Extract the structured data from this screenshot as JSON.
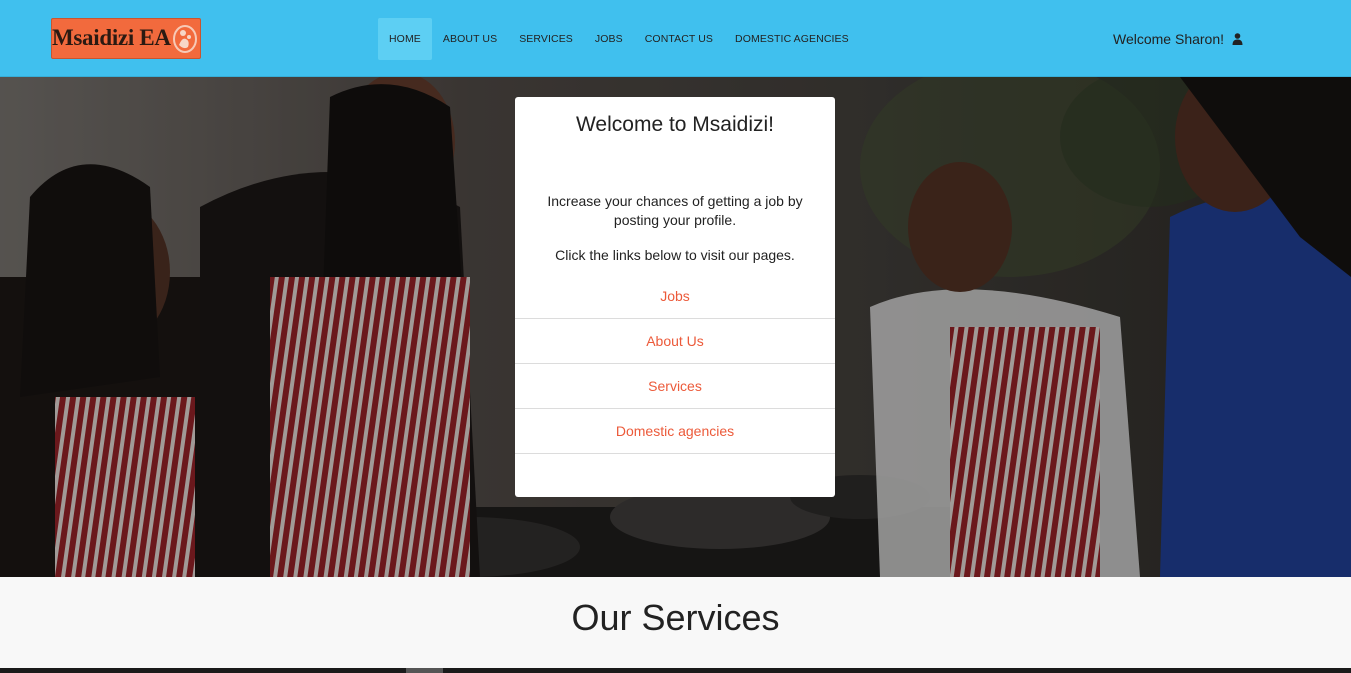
{
  "brand": {
    "logo_text": "Msaidizi EA",
    "logo_bg": "#f26a3d",
    "icon": "logo-mark-icon"
  },
  "nav": {
    "items": [
      {
        "label": "HOME",
        "active": true
      },
      {
        "label": "ABOUT US"
      },
      {
        "label": "SERVICES"
      },
      {
        "label": "JOBS"
      },
      {
        "label": "CONTACT US"
      },
      {
        "label": "DOMESTIC AGENCIES"
      }
    ],
    "bg": "#40c0ee"
  },
  "user": {
    "welcome": "Welcome Sharon!",
    "icon": "user-icon"
  },
  "card": {
    "title": "Welcome to Msaidizi!",
    "text1": "Increase your chances of getting a job by posting your profile.",
    "text2": "Click the links below to visit our pages.",
    "links": [
      "Jobs",
      "About Us",
      "Services",
      "Domestic agencies"
    ],
    "link_color": "#ec5a3a"
  },
  "services": {
    "title": "Our Services"
  }
}
